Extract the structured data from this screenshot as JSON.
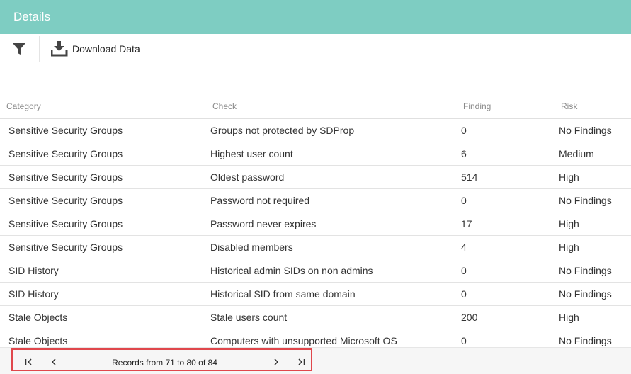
{
  "header": {
    "title": "Details"
  },
  "toolbar": {
    "filter_icon": "filter-icon",
    "download_icon": "download-icon",
    "download_label": "Download Data"
  },
  "table": {
    "columns": [
      "Category",
      "Check",
      "Finding",
      "Risk"
    ],
    "rows": [
      [
        "Sensitive Security Groups",
        "Groups not protected by SDProp",
        "0",
        "No Findings"
      ],
      [
        "Sensitive Security Groups",
        "Highest user count",
        "6",
        "Medium"
      ],
      [
        "Sensitive Security Groups",
        "Oldest password",
        "514",
        "High"
      ],
      [
        "Sensitive Security Groups",
        "Password not required",
        "0",
        "No Findings"
      ],
      [
        "Sensitive Security Groups",
        "Password never expires",
        "17",
        "High"
      ],
      [
        "Sensitive Security Groups",
        "Disabled members",
        "4",
        "High"
      ],
      [
        "SID History",
        "Historical admin SIDs on non admins",
        "0",
        "No Findings"
      ],
      [
        "SID History",
        "Historical SID from same domain",
        "0",
        "No Findings"
      ],
      [
        "Stale Objects",
        "Stale users count",
        "200",
        "High"
      ],
      [
        "Stale Objects",
        "Computers with unsupported Microsoft OS",
        "0",
        "No Findings"
      ]
    ]
  },
  "pager": {
    "first_label": "I<",
    "prev_label": "<",
    "next_label": ">",
    "last_label": ">I",
    "info": "Records from 71 to 80 of 84"
  },
  "colors": {
    "header_bg": "#7ecdc2",
    "highlight_border": "#e0474c"
  }
}
